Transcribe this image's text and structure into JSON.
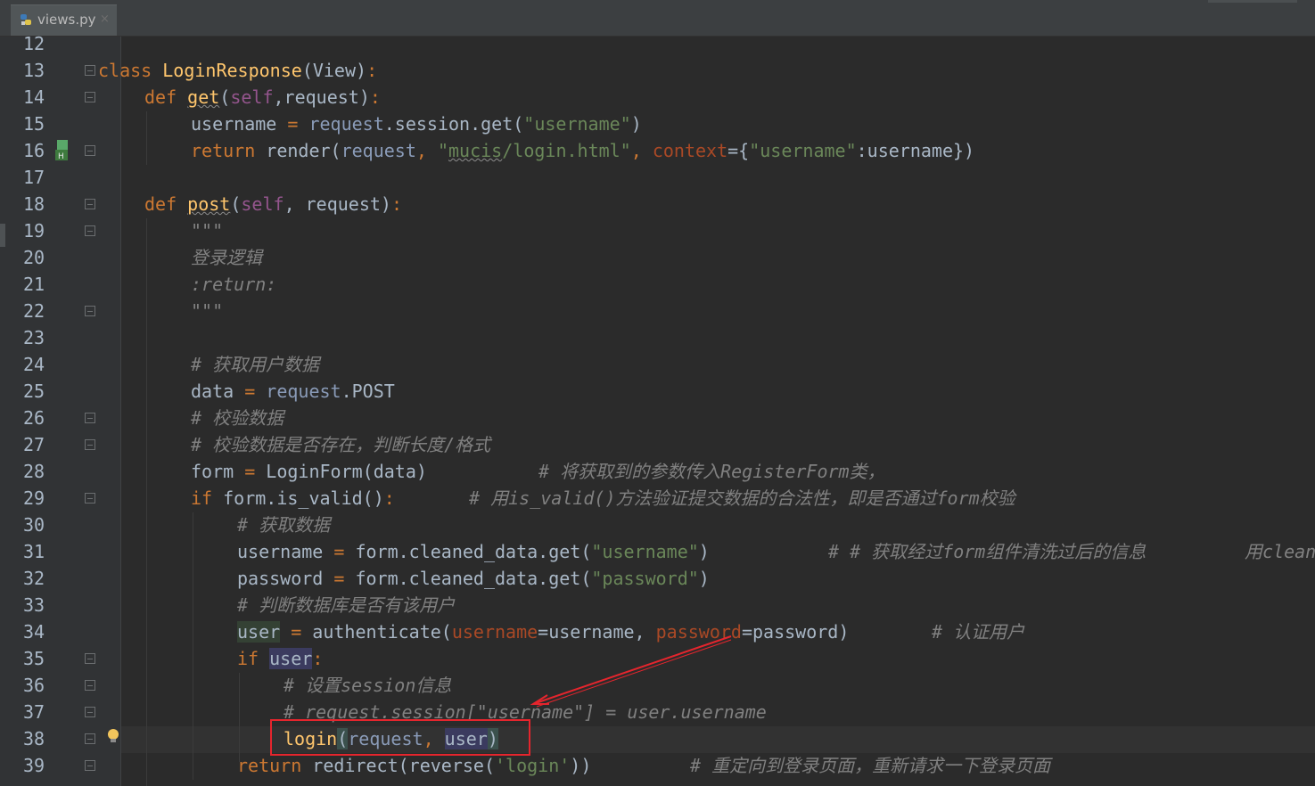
{
  "tab": {
    "title": "views.py",
    "close_glyph": "×",
    "icon": "python-file-icon"
  },
  "line_numbers": [
    "12",
    "13",
    "14",
    "15",
    "16",
    "17",
    "18",
    "19",
    "20",
    "21",
    "22",
    "23",
    "24",
    "25",
    "26",
    "27",
    "28",
    "29",
    "30",
    "31",
    "32",
    "33",
    "34",
    "35",
    "36",
    "37",
    "38",
    "39"
  ],
  "code": {
    "l13": {
      "kw": "class",
      "name": "LoginResponse",
      "base": "(View)",
      "colon": ":"
    },
    "l14": {
      "kw": "def",
      "name": "get",
      "open": "(",
      "self": "self",
      "rest": ",request)",
      "colon": ":"
    },
    "l15": {
      "a": "username",
      "eq": " = ",
      "b": "request",
      "c": ".session.get(",
      "s": "\"username\"",
      "d": ")"
    },
    "l16": {
      "kw": "return",
      "a": " render(",
      "b": "request",
      "c": ", ",
      "s1": "\"",
      "s2": "mucis",
      "s3": "/login.html\"",
      "d": ", ",
      "kwarg": "context",
      "e": "={",
      "s4": "\"username\"",
      "f": ":username})"
    },
    "l18": {
      "kw": "def",
      "name": "post",
      "open": "(",
      "self": "self",
      "rest": ", request)",
      "colon": ":"
    },
    "l19": "\"\"\"",
    "l20": "登录逻辑",
    "l21": ":return:",
    "l22": "\"\"\"",
    "l24": "# 获取用户数据",
    "l25": {
      "a": "data",
      "eq": " = ",
      "b": "request",
      "c": ".POST"
    },
    "l26": "# 校验数据",
    "l27": "# 校验数据是否存在，判断长度/格式",
    "l28": {
      "a": "form",
      "eq": " = ",
      "b": "LoginForm(data)",
      "com": "# 将获取到的参数传入RegisterForm类，"
    },
    "l29": {
      "kw": "if",
      "a": " form.is_valid()",
      "colon": ":",
      "com": "# 用is_valid()方法验证提交数据的合法性，即是否通过form校验"
    },
    "l30": "# 获取数据",
    "l31": {
      "a": "username",
      "eq": " = ",
      "b": "form.cleaned_data.get(",
      "s": "\"username\"",
      "d": ")",
      "com": "# # 获取经过form组件清洗过后的信息",
      "com2": "用clean"
    },
    "l32": {
      "a": "password",
      "eq": " = ",
      "b": "form.cleaned_data.get(",
      "s": "\"password\"",
      "d": ")"
    },
    "l33": "# 判断数据库是否有该用户",
    "l34": {
      "a": "user",
      "eq": " = ",
      "b": "authenticate(",
      "k1": "username",
      "c": "=username, ",
      "k2": "password",
      "d": "=password)",
      "com": "# 认证用户"
    },
    "l35": {
      "kw": "if",
      "sp": " ",
      "a": "user",
      "colon": ":"
    },
    "l36": "# 设置session信息",
    "l37": "# request.session[\"username\"] = user.username",
    "l38": {
      "a": "login",
      "p1": "(",
      "b": "request",
      "c": ", ",
      "d": "user",
      "p2": ")"
    },
    "l39": {
      "kw": "return",
      "a": " redirect(reverse(",
      "s": "'login'",
      "d": "))",
      "com": "# 重定向到登录页面，重新请求一下登录页面"
    }
  },
  "colors": {
    "background": "#2b2b2b",
    "gutter": "#313335",
    "keyword": "#cc7832",
    "function": "#ffc66d",
    "string": "#6a8759",
    "comment": "#808080",
    "self": "#94558d",
    "annotation_box": "#e5252d"
  }
}
